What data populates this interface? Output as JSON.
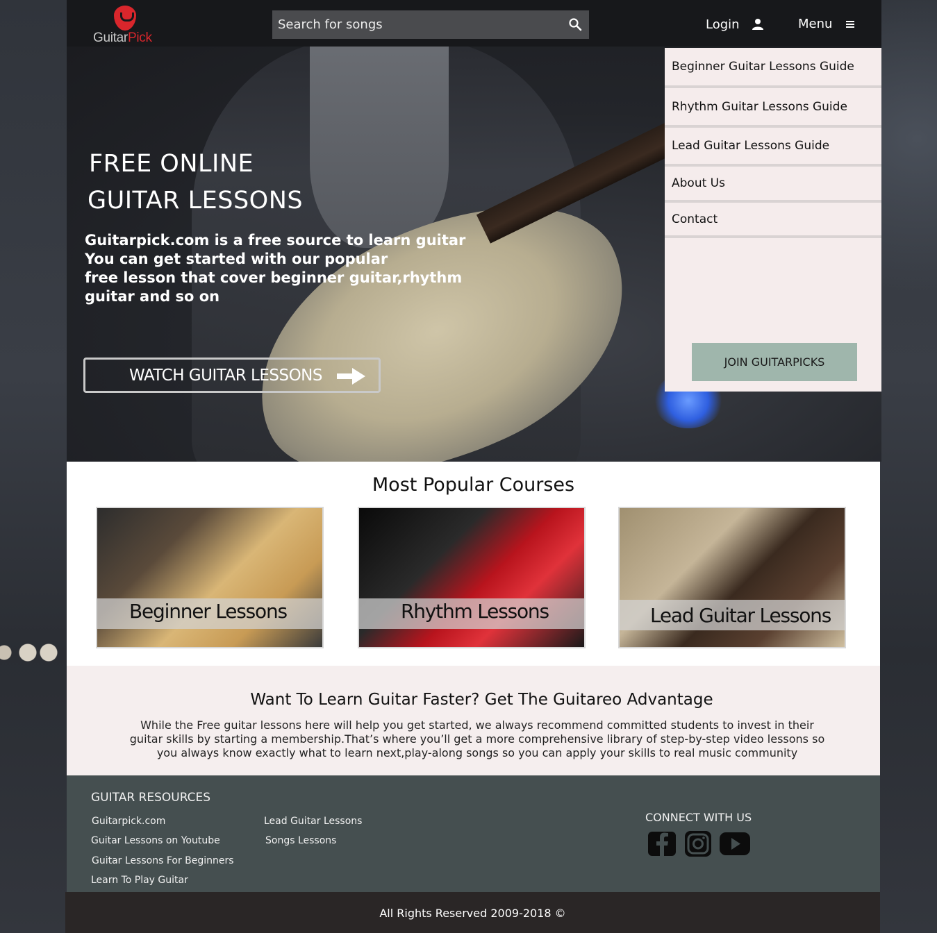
{
  "header": {
    "logo_part1": "Guitar",
    "logo_part2": "Pick",
    "search_placeholder": "Search for songs",
    "login_label": "Login",
    "menu_label": "Menu"
  },
  "hero": {
    "title_line1": "FREE ONLINE",
    "title_line2": "GUITAR LESSONS",
    "text_line1": "Guitarpick.com is a free source to learn guitar",
    "text_line2": "You can get started with our popular",
    "text_line3": "free lesson that cover beginner guitar,rhythm",
    "text_line4": "guitar and so on",
    "watch_label": "WATCH GUITAR LESSONS"
  },
  "dropdown": {
    "items": [
      "Beginner Guitar Lessons Guide",
      "Rhythm Guitar Lessons Guide",
      "Lead Guitar Lessons Guide",
      "About Us",
      "Contact"
    ],
    "join_label": "JOIN GUITARPICKS"
  },
  "courses": {
    "title": "Most Popular Courses",
    "cards": [
      "Beginner Lessons",
      "Rhythm Lessons",
      "Lead Guitar Lessons"
    ]
  },
  "advantage": {
    "title": "Want To Learn Guitar Faster? Get The Guitareo Advantage",
    "text": "While the Free guitar lessons here will help you get started, we always recommend committed students to invest in their guitar skills by starting a membership.That’s where you’ll get a more comprehensive library of step-by-step video lessons so you always know exactly what to learn next,play-along songs so you can apply your skills to real music community"
  },
  "footer": {
    "resources_title": "GUITAR RESOURCES",
    "links_col1": [
      "Guitarpick.com",
      "Guitar Lessons on Youtube",
      "Guitar Lessons For Beginners",
      "Learn To Play Guitar"
    ],
    "links_col2": [
      "Lead Guitar Lessons",
      "Songs Lessons"
    ],
    "connect_title": "CONNECT WITH US",
    "social_icons": [
      "facebook-icon",
      "instagram-icon",
      "youtube-icon"
    ],
    "copyright": "All Rights Reserved  2009-2018 ©"
  },
  "colors": {
    "brand_red": "#d9262c",
    "dropdown_bg": "#f5ecec",
    "join_button": "#9fb6ac",
    "footer_bg": "#454f50"
  }
}
